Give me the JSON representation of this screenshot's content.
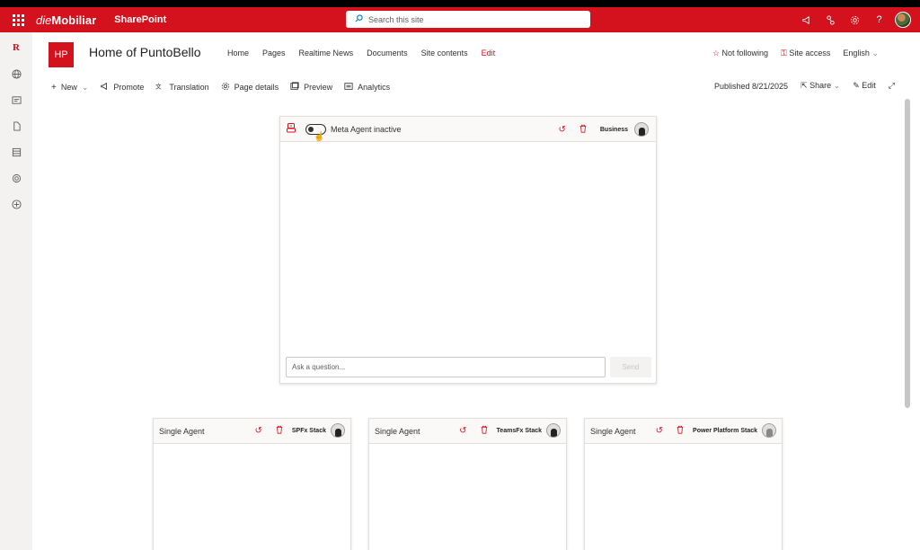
{
  "suite": {
    "brand_italic": "die",
    "brand_bold": "Mobiliar",
    "app": "SharePoint",
    "search_placeholder": "Search this site"
  },
  "site": {
    "logo": "HP",
    "title": "Home of PuntoBello",
    "nav": [
      "Home",
      "Pages",
      "Realtime News",
      "Documents",
      "Site contents",
      "Edit"
    ],
    "following": "Not following",
    "site_access": "Site access",
    "language": "English"
  },
  "commands": {
    "new": "New",
    "promote": "Promote",
    "translation": "Translation",
    "page_details": "Page details",
    "preview": "Preview",
    "analytics": "Analytics",
    "published": "Published 8/21/2025",
    "share": "Share",
    "edit": "Edit"
  },
  "meta_agent": {
    "toggle_label": "Meta Agent inactive",
    "toggle_on": false,
    "stack": "Business",
    "ask_placeholder": "Ask a question...",
    "send": "Send"
  },
  "agents": [
    {
      "title": "Single Agent",
      "stack": "SPFx Stack"
    },
    {
      "title": "Single Agent",
      "stack": "TeamsFx Stack"
    },
    {
      "title": "Single Agent",
      "stack": "Power Platform Stack"
    }
  ],
  "colors": {
    "brand_red": "#d4121e",
    "rail_bg": "#f3f2f1"
  }
}
